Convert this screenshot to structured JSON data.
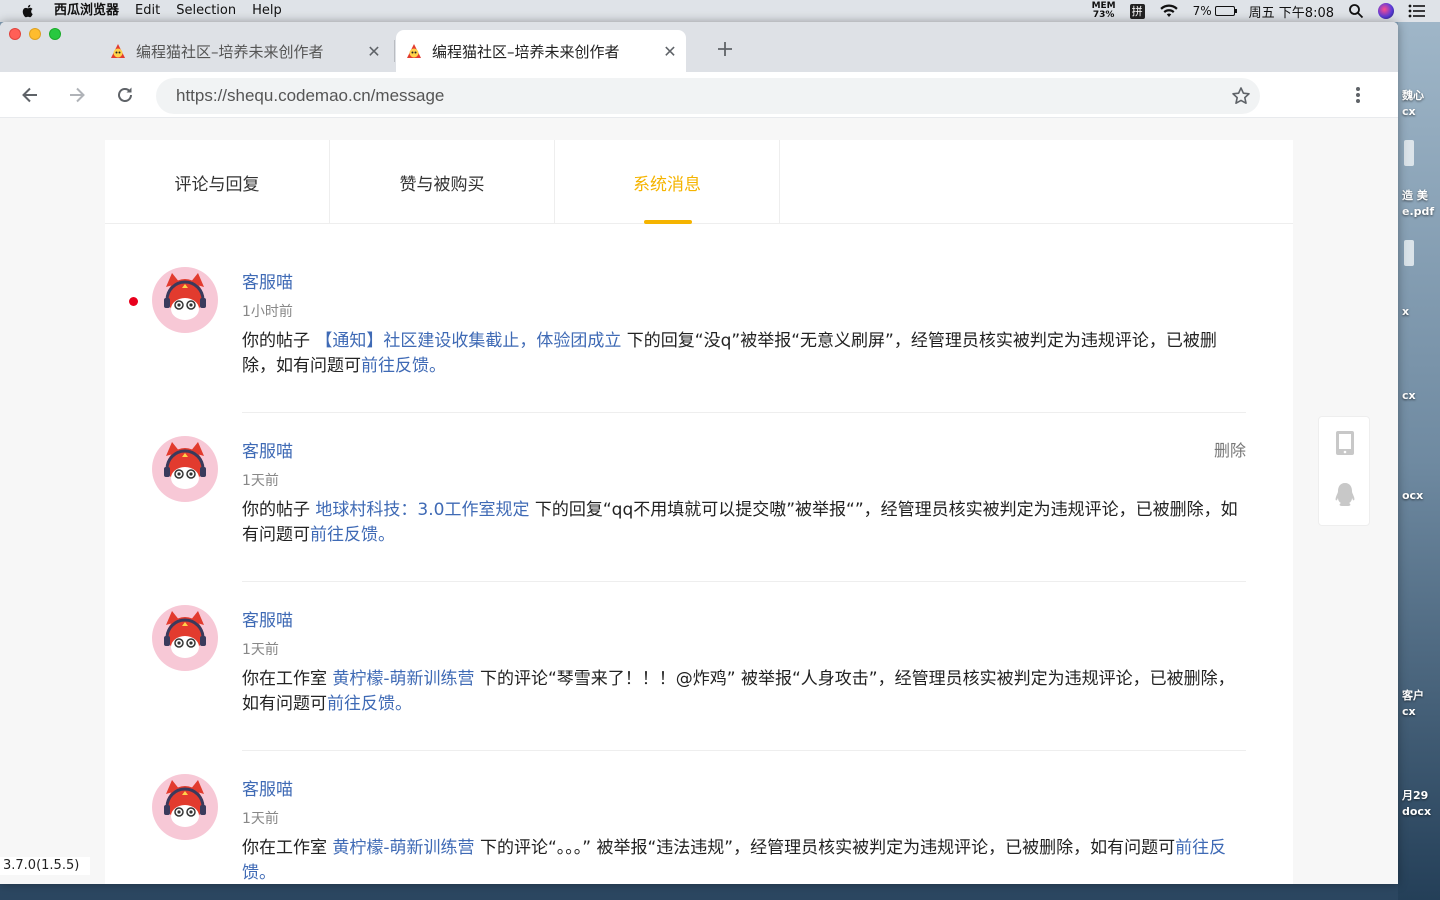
{
  "menubar": {
    "app_name": "西瓜浏览器",
    "items": [
      "Edit",
      "Selection",
      "Help"
    ],
    "mem_label": "MEM",
    "mem_value": "73%",
    "input_method": "拼",
    "battery": "7%",
    "clock": "周五 下午8:08"
  },
  "tabs": [
    {
      "title": "编程猫社区–培养未来创作者",
      "active": false
    },
    {
      "title": "编程猫社区–培养未来创作者",
      "active": true
    }
  ],
  "toolbar": {
    "url": "https://shequ.codemao.cn/message"
  },
  "message_tabs": [
    {
      "label": "评论与回复",
      "active": false
    },
    {
      "label": "赞与被购买",
      "active": false
    },
    {
      "label": "系统消息",
      "active": true
    }
  ],
  "messages": [
    {
      "sender": "客服喵",
      "time": "1小时前",
      "unread": true,
      "prefix": "你的帖子 ",
      "link": "【通知】社区建设收集截止，体验团成立",
      "middle": " 下的回复“没q”被举报“无意义刷屏”，经管理员核实被判定为违规评论，已被删除，如有问题可",
      "feedback": "前往反馈。",
      "delete_label": ""
    },
    {
      "sender": "客服喵",
      "time": "1天前",
      "unread": false,
      "prefix": "你的帖子 ",
      "link": "地球村科技：3.0工作室规定",
      "middle": " 下的回复“qq不用填就可以提交嗷”被举报“”，经管理员核实被判定为违规评论，已被删除，如有问题可",
      "feedback": "前往反馈。",
      "delete_label": "删除"
    },
    {
      "sender": "客服喵",
      "time": "1天前",
      "unread": false,
      "prefix": "你在工作室 ",
      "link": "黄柠檬-萌新训练营",
      "middle": " 下的评论“琴雪来了！！！@炸鸡” 被举报“人身攻击”，经管理员核实被判定为违规评论，已被删除，如有问题可",
      "feedback": "前往反馈。",
      "delete_label": ""
    },
    {
      "sender": "客服喵",
      "time": "1天前",
      "unread": false,
      "prefix": "你在工作室 ",
      "link": "黄柠檬-萌新训练营",
      "middle": " 下的评论“。。。” 被举报“违法违规”，经管理员核实被判定为违规评论，已被删除，如有问题可",
      "feedback": "前往反馈。",
      "delete_label": ""
    }
  ],
  "version": "3.7.0(1.5.5)",
  "desktop_labels": [
    "魏心",
    "cx",
    "造 美",
    "e.pdf",
    "x",
    "cx",
    "ocx",
    "客户",
    "cx",
    "月29",
    "docx"
  ],
  "colors": {
    "accent": "#f5b400",
    "link": "#3f6ab5",
    "unread_dot": "#e8001c"
  }
}
